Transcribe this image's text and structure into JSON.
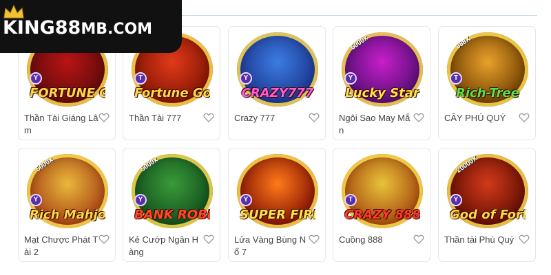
{
  "brand": {
    "logo_main": "KING88",
    "logo_suffix": "MB.COM",
    "accent_color": "#f2c232"
  },
  "games": [
    {
      "name": "Thần Tài Giáng Lâm",
      "logo": "FORTUNE GOD COMING",
      "badge": "Y",
      "multiplier": "",
      "bg": [
        "#b81414",
        "#5a0a0a"
      ],
      "logo_color": "#ffd84a"
    },
    {
      "name": "Thần Tài 777",
      "logo": "Fortune God",
      "badge": "T",
      "multiplier": "",
      "bg": [
        "#e23a1a",
        "#7a1200"
      ],
      "logo_color": "#ffd84a"
    },
    {
      "name": "Crazy 777",
      "logo": "CRAZY777",
      "badge": "Y",
      "multiplier": "",
      "bg": [
        "#3a7de0",
        "#1a2f8a"
      ],
      "logo_color": "#ff5ad8"
    },
    {
      "name": "Ngôi Sao May Mắn",
      "logo": "Lucky Star",
      "badge": "Y",
      "multiplier": "5000x",
      "bg": [
        "#c61fc9",
        "#4c0d6e"
      ],
      "logo_color": "#ffe34a"
    },
    {
      "name": "CÂY PHÚ QUÝ",
      "logo": "Rich-Tree",
      "badge": "T",
      "multiplier": "388X",
      "bg": [
        "#e8a12a",
        "#6a3a00"
      ],
      "logo_color": "#57e24a"
    },
    {
      "name": "Mạt Chược Phát Tài 2",
      "logo": "Rich Mahjong",
      "badge": "Y",
      "multiplier": "5000x",
      "bg": [
        "#e8b83c",
        "#a33a10"
      ],
      "logo_color": "#ffd84a"
    },
    {
      "name": "Kẻ Cướp Ngân Hàng",
      "logo": "BANK ROBBERY",
      "badge": "Y",
      "multiplier": "5000x",
      "bg": [
        "#3a9a3a",
        "#0f4a1a"
      ],
      "logo_color": "#ff4a2a"
    },
    {
      "name": "Lửa Vàng Bùng Nổ 7",
      "logo": "SUPER FIRE",
      "badge": "Y",
      "multiplier": "",
      "bg": [
        "#ff7a1a",
        "#7a0a00"
      ],
      "logo_color": "#ffe34a"
    },
    {
      "name": "Cuồng 888",
      "logo": "CRAZY 888",
      "badge": "T",
      "multiplier": "",
      "bg": [
        "#e8c23a",
        "#a3420a"
      ],
      "logo_color": "#ff3a2a"
    },
    {
      "name": "Thần tài Phú Quý",
      "logo": "God of Fortune",
      "badge": "Y",
      "multiplier": "20000X",
      "bg": [
        "#d23a1a",
        "#5a0a00"
      ],
      "logo_color": "#ffd84a"
    }
  ],
  "icons": {
    "favorite": "heart-outline-icon",
    "badge": "provider-badge-icon",
    "brand": "crown-icon"
  }
}
